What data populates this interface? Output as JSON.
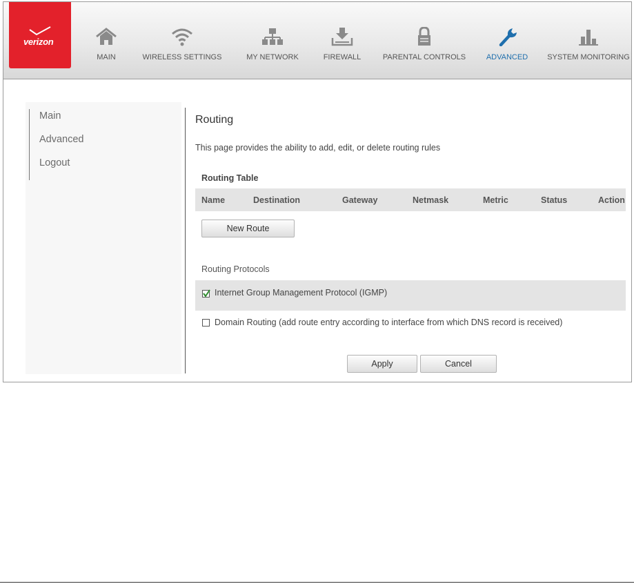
{
  "header": {
    "logo_text": "verizon",
    "nav": [
      {
        "label": "MAIN",
        "icon": "home-icon"
      },
      {
        "label": "WIRELESS SETTINGS",
        "icon": "wifi-icon"
      },
      {
        "label": "MY NETWORK",
        "icon": "network-icon"
      },
      {
        "label": "FIREWALL",
        "icon": "firewall-icon"
      },
      {
        "label": "PARENTAL CONTROLS",
        "icon": "lock-icon"
      },
      {
        "label": "ADVANCED",
        "icon": "wrench-icon",
        "active": true
      },
      {
        "label": "SYSTEM MONITORING",
        "icon": "bar-chart-icon"
      }
    ]
  },
  "sidebar": {
    "items": [
      {
        "label": "Main"
      },
      {
        "label": "Advanced"
      },
      {
        "label": "Logout"
      }
    ]
  },
  "content": {
    "title": "Routing",
    "description": "This page provides the ability to add, edit, or delete routing rules",
    "routing_table_label": "Routing Table",
    "columns": [
      "Name",
      "Destination",
      "Gateway",
      "Netmask",
      "Metric",
      "Status",
      "Action"
    ],
    "new_route_label": "New Route",
    "routing_protocols_label": "Routing Protocols",
    "protocols": [
      {
        "label": "Internet Group Management Protocol (IGMP)",
        "checked": true
      },
      {
        "label": "Domain Routing (add route entry according to interface from which DNS record is received)",
        "checked": false
      }
    ],
    "apply_label": "Apply",
    "cancel_label": "Cancel"
  },
  "colors": {
    "brand_red": "#e3212b",
    "accent_blue": "#1f6fad",
    "icon_gray": "#8a8a8a"
  }
}
